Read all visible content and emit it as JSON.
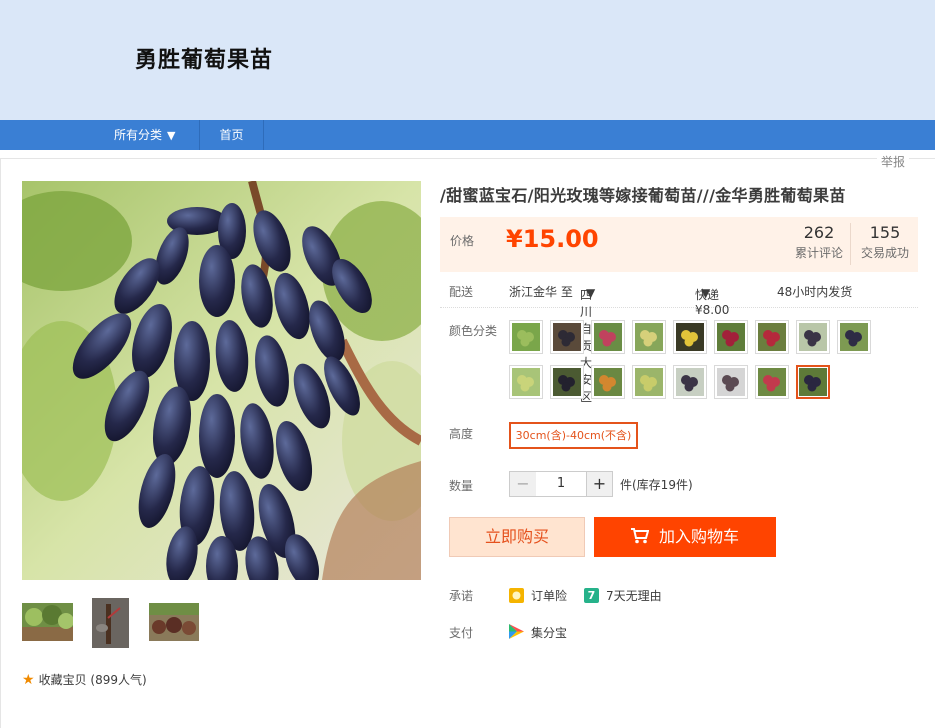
{
  "shop": {
    "name": "勇胜葡萄果苗"
  },
  "nav": {
    "all_categories": "所有分类",
    "home": "首页"
  },
  "report": "举报",
  "product": {
    "title": "/甜蜜蓝宝石/阳光玫瑰等嫁接葡萄苗///金华勇胜葡萄果苗",
    "price_label": "价格",
    "price": "¥15.00",
    "reviews_count": "262",
    "reviews_label": "累计评论",
    "sales_count": "155",
    "sales_label": "交易成功"
  },
  "delivery": {
    "label": "配送",
    "from": "浙江金华 至",
    "to": "四川自贡大安区",
    "shipping": "快递 ¥8.00",
    "ship_time": "48小时内发货"
  },
  "color": {
    "label": "颜色分类",
    "swatches": [
      {
        "fill": "#7aa64a",
        "fruit": "#9bbd5d"
      },
      {
        "fill": "#5a4a3a",
        "fruit": "#2d2a35"
      },
      {
        "fill": "#6a8d45",
        "fruit": "#c0425e"
      },
      {
        "fill": "#87a65a",
        "fruit": "#d6d07a"
      },
      {
        "fill": "#3a3a25",
        "fruit": "#e2c43a"
      },
      {
        "fill": "#5f7d3a",
        "fruit": "#a2203a"
      },
      {
        "fill": "#6b7e3e",
        "fruit": "#b5293c"
      },
      {
        "fill": "#b9c6a8",
        "fruit": "#3a3346"
      },
      {
        "fill": "#7d9a52",
        "fruit": "#2e2c45"
      },
      {
        "fill": "#a8c478",
        "fruit": "#c9d47a"
      },
      {
        "fill": "#4b5a32",
        "fruit": "#23212e"
      },
      {
        "fill": "#6a8842",
        "fruit": "#d2872f"
      },
      {
        "fill": "#9bb56a",
        "fruit": "#c8cc6a"
      },
      {
        "fill": "#c7cfc2",
        "fruit": "#3b3446"
      },
      {
        "fill": "#d5d5d5",
        "fruit": "#5b4a52"
      },
      {
        "fill": "#6e8a43",
        "fruit": "#c23a4d"
      },
      {
        "fill": "#5e7a38",
        "fruit": "#2a2740"
      }
    ]
  },
  "height": {
    "label": "高度",
    "option": "30cm(含)-40cm(不含)"
  },
  "quantity": {
    "label": "数量",
    "value": "1",
    "minus": "−",
    "plus": "+",
    "stock": "件(库存19件)"
  },
  "actions": {
    "buy_now": "立即购买",
    "add_to_cart": "加入购物车"
  },
  "promise": {
    "label": "承诺",
    "insurance": "订单险",
    "return_icon": "7",
    "return": "7天无理由"
  },
  "payment": {
    "label": "支付",
    "method": "集分宝"
  },
  "favorite": {
    "text": "收藏宝贝",
    "popularity": "(899人气)"
  },
  "colors": {
    "accent": "#ff4400",
    "nav": "#3a7fd4",
    "header_bg": "#dae7f8",
    "price_bg": "#fff2e8"
  }
}
